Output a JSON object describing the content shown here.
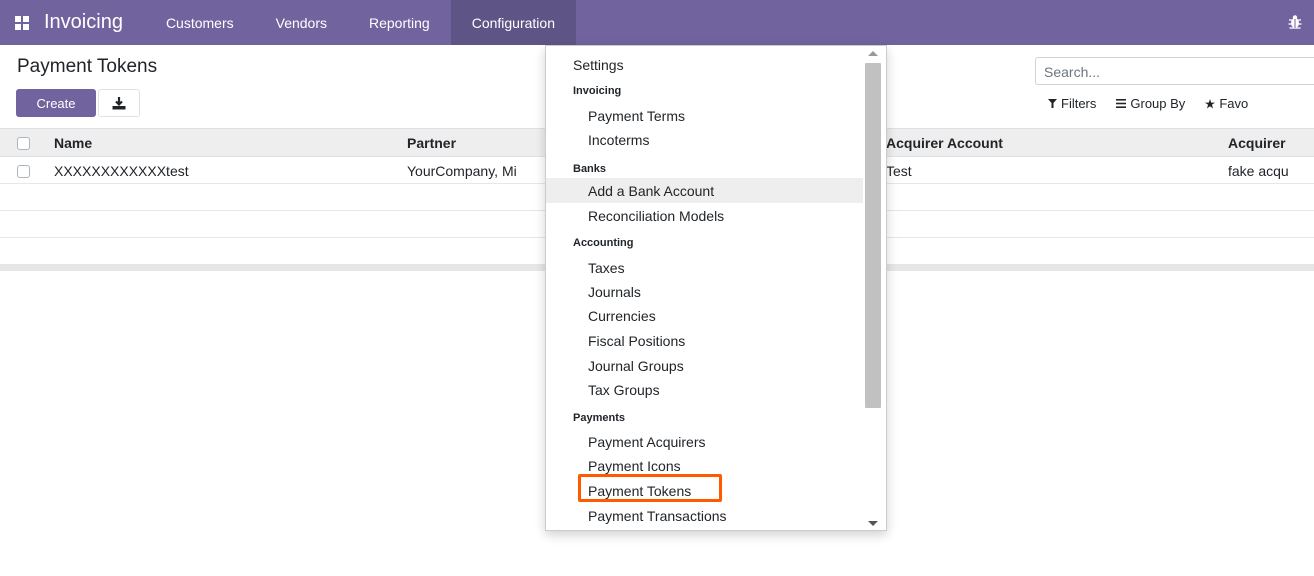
{
  "navbar": {
    "brand": "Invoicing",
    "items": [
      {
        "label": "Customers"
      },
      {
        "label": "Vendors"
      },
      {
        "label": "Reporting"
      },
      {
        "label": "Configuration"
      }
    ],
    "accent": "#71639e",
    "active_bg": "#5f5486",
    "icons": [
      "apps-grid-icon",
      "bug-icon"
    ]
  },
  "control_panel": {
    "title": "Payment Tokens",
    "create_label": "Create",
    "search_placeholder": "Search...",
    "filters_label": "Filters",
    "group_by_label": "Group By",
    "favorites_label": "Favo"
  },
  "table": {
    "columns": [
      "Name",
      "Partner",
      "Acquirer Account",
      "Acquirer"
    ],
    "rows": [
      {
        "name": "XXXXXXXXXXXXtest",
        "partner": "YourCompany, Mi",
        "acquirer_account": "Test",
        "acquirer": "fake acqu"
      }
    ]
  },
  "dropdown": {
    "settings": "Settings",
    "sections": [
      {
        "header": "Invoicing",
        "items": [
          "Payment Terms",
          "Incoterms"
        ]
      },
      {
        "header": "Banks",
        "items": [
          "Add a Bank Account",
          "Reconciliation Models"
        ]
      },
      {
        "header": "Accounting",
        "items": [
          "Taxes",
          "Journals",
          "Currencies",
          "Fiscal Positions",
          "Journal Groups",
          "Tax Groups"
        ]
      },
      {
        "header": "Payments",
        "items": [
          "Payment Acquirers",
          "Payment Icons",
          "Payment Tokens",
          "Payment Transactions"
        ]
      }
    ],
    "highlight_color": "#ff5a00"
  }
}
